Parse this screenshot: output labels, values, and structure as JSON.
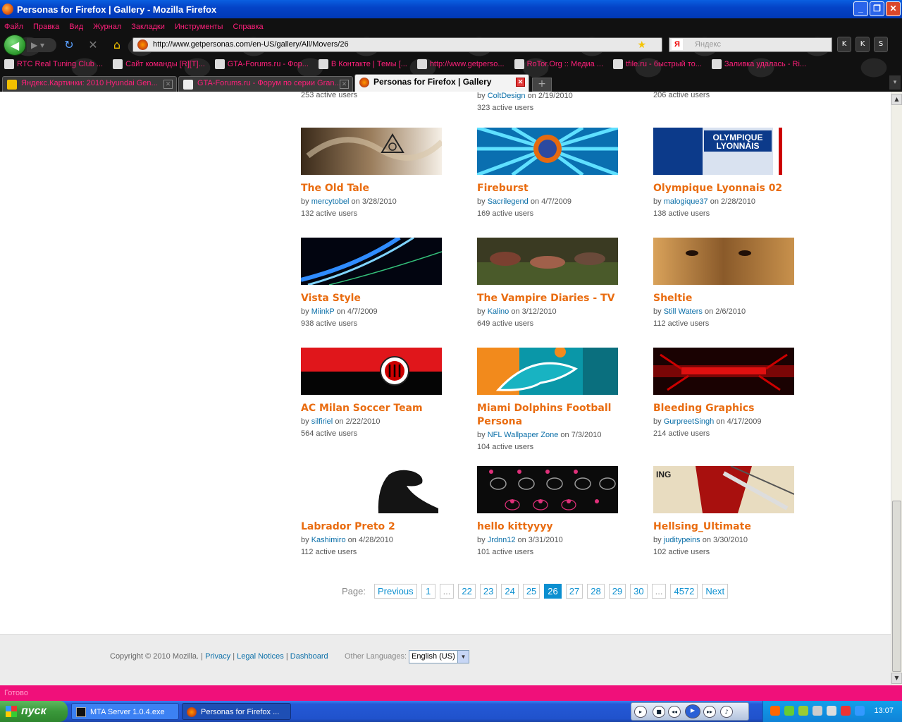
{
  "window": {
    "title": "Personas for Firefox | Gallery - Mozilla Firefox"
  },
  "menu": [
    "Файл",
    "Правка",
    "Вид",
    "Журнал",
    "Закладки",
    "Инструменты",
    "Справка"
  ],
  "address": {
    "url": "http://www.getpersonas.com/en-US/gallery/All/Movers/26"
  },
  "search": {
    "placeholder": "Яндекс"
  },
  "bookmarks": [
    "RTC Real Tuning Club ...",
    "Сайт команды [R][T]...",
    "GTA-Forums.ru - Фор...",
    "В Контакте | Темы [...",
    "http://www.getperso...",
    "RoTor.Org :: Медиа ...",
    "tfile.ru - быстрый то...",
    "Заливка удалась - Ri..."
  ],
  "tabs": [
    {
      "label": "Яндекс.Картинки: 2010 Hyundai Gen..."
    },
    {
      "label": "GTA-Forums.ru - Форум по серии Gran..."
    },
    {
      "label": "Personas for Firefox | Gallery"
    }
  ],
  "top_partial": {
    "c1_users": "253 active users",
    "c2_by": "by",
    "c2_author": "ColtDesign",
    "c2_date": "on 2/19/2010",
    "c2_users": "323 active users",
    "c3_users": "206 active users"
  },
  "personas": [
    {
      "title": "The Old Tale",
      "author": "mercytobel",
      "date": "on 3/28/2010",
      "users": "132 active users"
    },
    {
      "title": "Fireburst",
      "author": "Sacrilegend",
      "date": "on 4/7/2009",
      "users": "169 active users"
    },
    {
      "title": "Olympique Lyonnais 02",
      "author": "malogique37",
      "date": "on 2/28/2010",
      "users": "138 active users"
    },
    {
      "title": "Vista Style",
      "author": "MiinkP",
      "date": "on 4/7/2009",
      "users": "938 active users"
    },
    {
      "title": "The Vampire Diaries - TV",
      "author": "Kalino",
      "date": "on 3/12/2010",
      "users": "649 active users"
    },
    {
      "title": "Sheltie",
      "author": "Still Waters",
      "date": "on 2/6/2010",
      "users": "112 active users"
    },
    {
      "title": "AC Milan Soccer Team",
      "author": "silfiriel",
      "date": "on 2/22/2010",
      "users": "564 active users"
    },
    {
      "title": "Miami Dolphins Football Persona",
      "author": "NFL Wallpaper Zone",
      "date": "on 7/3/2010",
      "users": "104 active users"
    },
    {
      "title": "Bleeding Graphics",
      "author": "GurpreetSingh",
      "date": "on 4/17/2009",
      "users": "214 active users"
    },
    {
      "title": "Labrador Preto 2",
      "author": "Kashimiro",
      "date": "on 4/28/2010",
      "users": "112 active users"
    },
    {
      "title": "hello kittyyyy",
      "author": "Jrdnn12",
      "date": "on 3/31/2010",
      "users": "101 active users"
    },
    {
      "title": "Hellsing_Ultimate",
      "author": "juditypeins",
      "date": "on 3/30/2010",
      "users": "102 active users"
    }
  ],
  "by_word": "by",
  "pager": {
    "label": "Page:",
    "prev": "Previous",
    "next": "Next",
    "pages": [
      "1",
      "...",
      "22",
      "23",
      "24",
      "25",
      "26",
      "27",
      "28",
      "29",
      "30",
      "...",
      "4572"
    ],
    "current": "26"
  },
  "footer": {
    "copyright": "Copyright © 2010 Mozilla. |",
    "privacy": "Privacy",
    "legal": "Legal Notices",
    "dashboard": "Dashboard",
    "sep": "|",
    "other_languages": "Other Languages:",
    "language": "English (US)"
  },
  "status": "Готово",
  "taskbar": {
    "start": "пуск",
    "task1": "MTA Server 1.0.4.exe",
    "task2": "Personas for Firefox ...",
    "clock": "13:07"
  }
}
